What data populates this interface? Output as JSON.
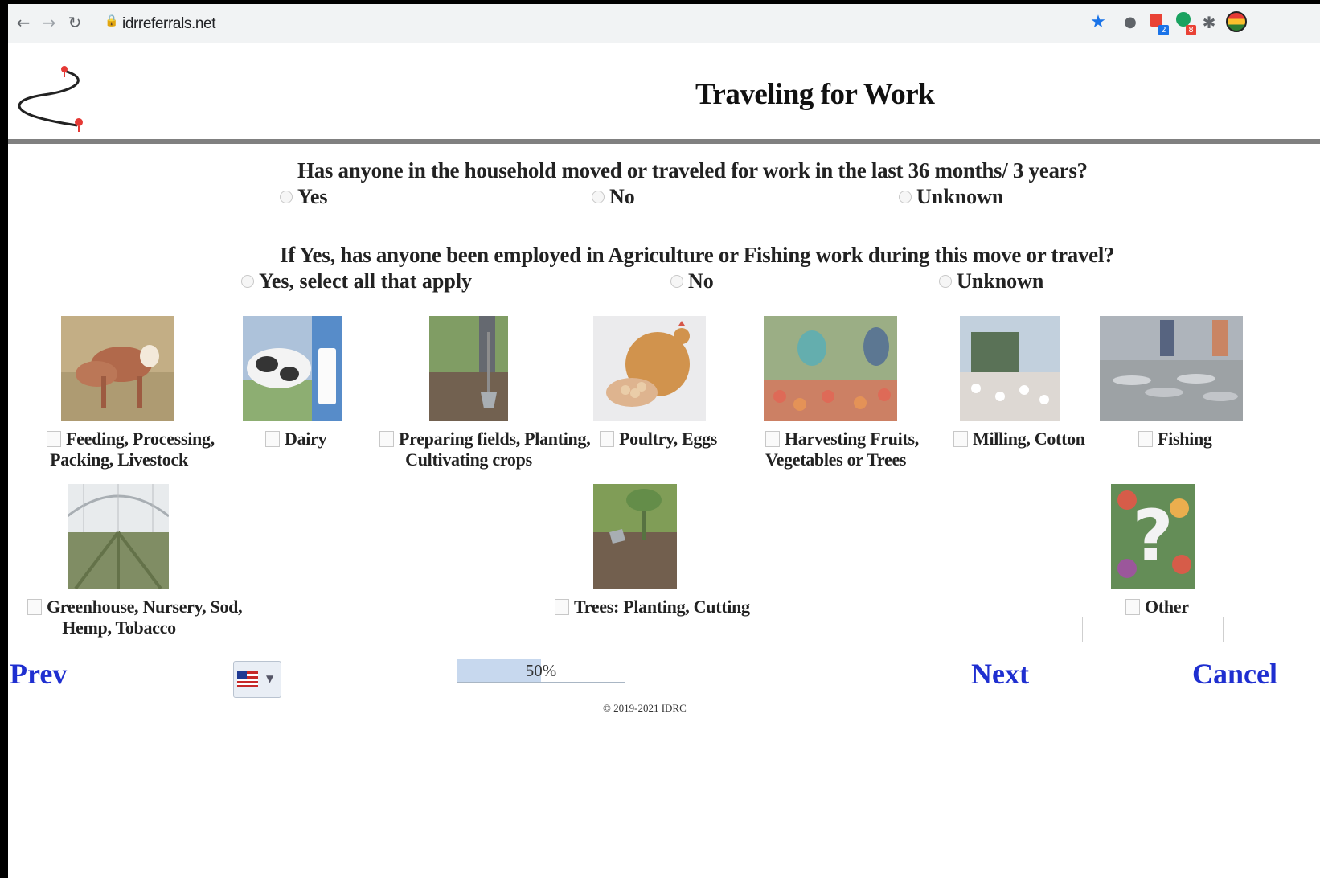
{
  "browser": {
    "url": "idrreferrals.net"
  },
  "page": {
    "title": "Traveling for Work"
  },
  "q1": {
    "text": "Has anyone in the household moved or traveled for work in the last 36 months/ 3 years?",
    "options": [
      "Yes",
      "No",
      "Unknown"
    ]
  },
  "q2": {
    "text": "If Yes, has anyone been employed in Agriculture or Fishing work during this move or travel?",
    "options": [
      "Yes, select all that apply",
      "No",
      "Unknown"
    ]
  },
  "categories": [
    {
      "line1": "Feeding, Processing,",
      "line2": "Packing, Livestock",
      "icon": "cattle-photo"
    },
    {
      "line1": "Dairy",
      "line2": "",
      "icon": "dairy-photo"
    },
    {
      "line1": "Preparing fields, Planting,",
      "line2": "Cultivating crops",
      "icon": "planting-photo"
    },
    {
      "line1": "Poultry, Eggs",
      "line2": "",
      "icon": "poultry-photo"
    },
    {
      "line1": "Harvesting Fruits,",
      "line2": "Vegetables or Trees",
      "icon": "harvest-photo"
    },
    {
      "line1": "Milling, Cotton",
      "line2": "",
      "icon": "cotton-photo"
    },
    {
      "line1": "Fishing",
      "line2": "",
      "icon": "fishing-photo"
    },
    {
      "line1": "Greenhouse, Nursery, Sod,",
      "line2": "Hemp, Tobacco",
      "icon": "greenhouse-photo"
    },
    {
      "line1": "Trees: Planting, Cutting",
      "line2": "",
      "icon": "tree-planting-photo"
    },
    {
      "line1": "Other",
      "line2": "",
      "icon": "question-mark-photo"
    }
  ],
  "nav": {
    "prev": "Prev",
    "next": "Next",
    "cancel": "Cancel"
  },
  "progress": {
    "value": 0.5,
    "label": "50%"
  },
  "footer": {
    "copyright": "© 2019-2021 IDRC"
  },
  "colors": {
    "link": "#1f2fd0",
    "divider": "#808080"
  }
}
